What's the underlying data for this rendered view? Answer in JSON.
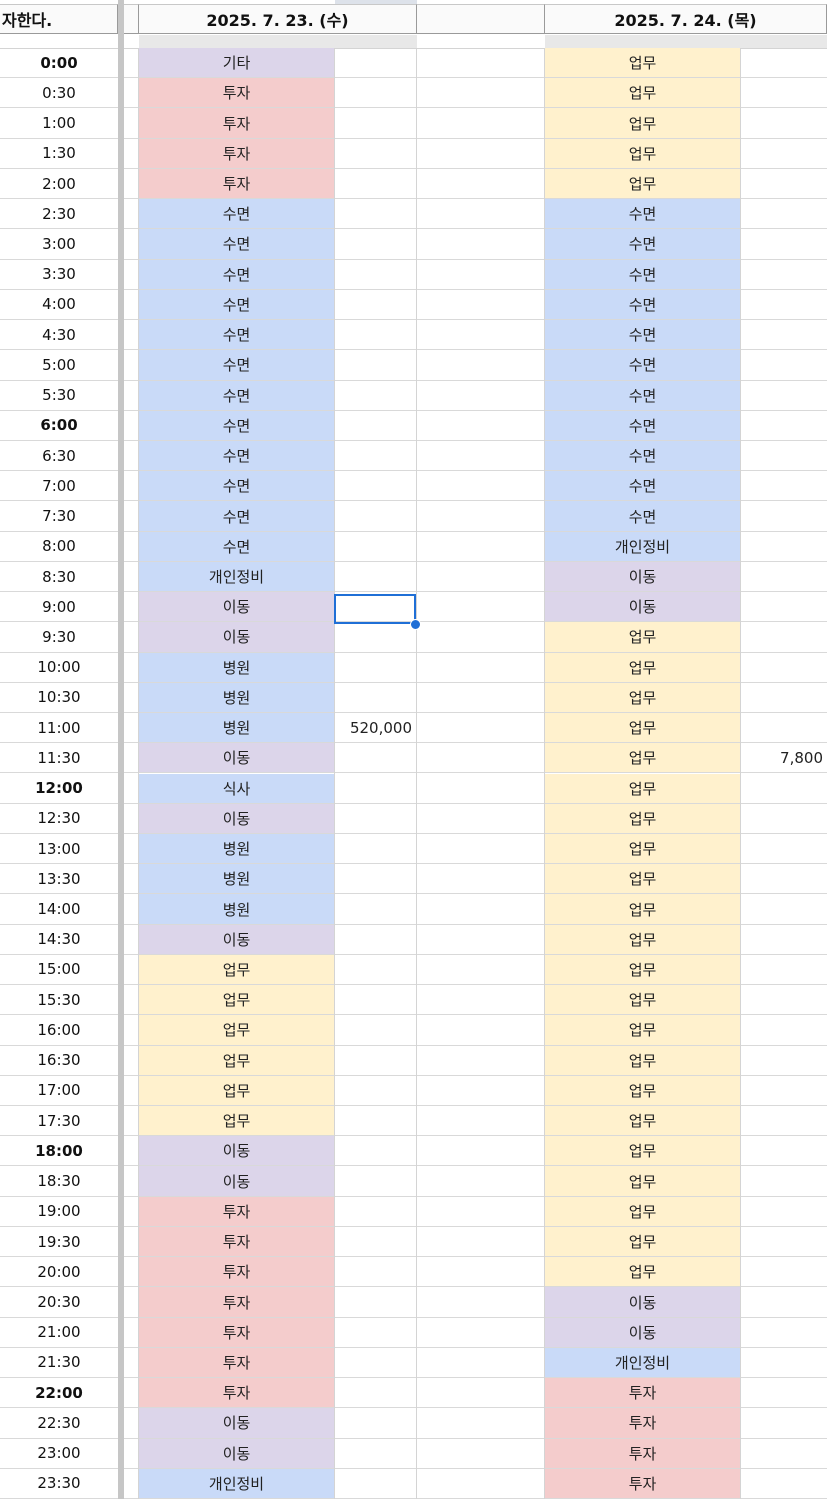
{
  "header": {
    "a": "자한다.",
    "date1": "2025. 7. 23. (수)",
    "date2": "2025. 7. 24. (목)"
  },
  "colors": {
    "기타": "#dcd5ea",
    "투자": "#f4cccc",
    "수면": "#c9daf8",
    "이동": "#dcd5ea",
    "병원": "#c9daf8",
    "개인정비": "#c9daf8",
    "식사": "#c9daf8",
    "업무": "#fff1cd"
  },
  "rows": [
    {
      "time": "0:00",
      "bold": true,
      "cat1": "기타",
      "amt1": "",
      "cat2": "업무",
      "amt2": ""
    },
    {
      "time": "0:30",
      "bold": false,
      "cat1": "투자",
      "amt1": "",
      "cat2": "업무",
      "amt2": ""
    },
    {
      "time": "1:00",
      "bold": false,
      "cat1": "투자",
      "amt1": "",
      "cat2": "업무",
      "amt2": ""
    },
    {
      "time": "1:30",
      "bold": false,
      "cat1": "투자",
      "amt1": "",
      "cat2": "업무",
      "amt2": ""
    },
    {
      "time": "2:00",
      "bold": false,
      "cat1": "투자",
      "amt1": "",
      "cat2": "업무",
      "amt2": ""
    },
    {
      "time": "2:30",
      "bold": false,
      "cat1": "수면",
      "amt1": "",
      "cat2": "수면",
      "amt2": ""
    },
    {
      "time": "3:00",
      "bold": false,
      "cat1": "수면",
      "amt1": "",
      "cat2": "수면",
      "amt2": ""
    },
    {
      "time": "3:30",
      "bold": false,
      "cat1": "수면",
      "amt1": "",
      "cat2": "수면",
      "amt2": ""
    },
    {
      "time": "4:00",
      "bold": false,
      "cat1": "수면",
      "amt1": "",
      "cat2": "수면",
      "amt2": ""
    },
    {
      "time": "4:30",
      "bold": false,
      "cat1": "수면",
      "amt1": "",
      "cat2": "수면",
      "amt2": ""
    },
    {
      "time": "5:00",
      "bold": false,
      "cat1": "수면",
      "amt1": "",
      "cat2": "수면",
      "amt2": ""
    },
    {
      "time": "5:30",
      "bold": false,
      "cat1": "수면",
      "amt1": "",
      "cat2": "수면",
      "amt2": ""
    },
    {
      "time": "6:00",
      "bold": true,
      "cat1": "수면",
      "amt1": "",
      "cat2": "수면",
      "amt2": ""
    },
    {
      "time": "6:30",
      "bold": false,
      "cat1": "수면",
      "amt1": "",
      "cat2": "수면",
      "amt2": ""
    },
    {
      "time": "7:00",
      "bold": false,
      "cat1": "수면",
      "amt1": "",
      "cat2": "수면",
      "amt2": ""
    },
    {
      "time": "7:30",
      "bold": false,
      "cat1": "수면",
      "amt1": "",
      "cat2": "수면",
      "amt2": ""
    },
    {
      "time": "8:00",
      "bold": false,
      "cat1": "수면",
      "amt1": "",
      "cat2": "개인정비",
      "amt2": ""
    },
    {
      "time": "8:30",
      "bold": false,
      "cat1": "개인정비",
      "amt1": "",
      "cat2": "이동",
      "amt2": ""
    },
    {
      "time": "9:00",
      "bold": false,
      "cat1": "이동",
      "amt1": "",
      "cat2": "이동",
      "amt2": ""
    },
    {
      "time": "9:30",
      "bold": false,
      "cat1": "이동",
      "amt1": "",
      "cat2": "업무",
      "amt2": ""
    },
    {
      "time": "10:00",
      "bold": false,
      "cat1": "병원",
      "amt1": "",
      "cat2": "업무",
      "amt2": ""
    },
    {
      "time": "10:30",
      "bold": false,
      "cat1": "병원",
      "amt1": "",
      "cat2": "업무",
      "amt2": ""
    },
    {
      "time": "11:00",
      "bold": false,
      "cat1": "병원",
      "amt1": "520,000",
      "cat2": "업무",
      "amt2": ""
    },
    {
      "time": "11:30",
      "bold": false,
      "cat1": "이동",
      "amt1": "",
      "cat2": "업무",
      "amt2": "7,800"
    },
    {
      "time": "12:00",
      "bold": true,
      "cat1": "식사",
      "amt1": "",
      "cat2": "업무",
      "amt2": ""
    },
    {
      "time": "12:30",
      "bold": false,
      "cat1": "이동",
      "amt1": "",
      "cat2": "업무",
      "amt2": ""
    },
    {
      "time": "13:00",
      "bold": false,
      "cat1": "병원",
      "amt1": "",
      "cat2": "업무",
      "amt2": ""
    },
    {
      "time": "13:30",
      "bold": false,
      "cat1": "병원",
      "amt1": "",
      "cat2": "업무",
      "amt2": ""
    },
    {
      "time": "14:00",
      "bold": false,
      "cat1": "병원",
      "amt1": "",
      "cat2": "업무",
      "amt2": ""
    },
    {
      "time": "14:30",
      "bold": false,
      "cat1": "이동",
      "amt1": "",
      "cat2": "업무",
      "amt2": ""
    },
    {
      "time": "15:00",
      "bold": false,
      "cat1": "업무",
      "amt1": "",
      "cat2": "업무",
      "amt2": ""
    },
    {
      "time": "15:30",
      "bold": false,
      "cat1": "업무",
      "amt1": "",
      "cat2": "업무",
      "amt2": ""
    },
    {
      "time": "16:00",
      "bold": false,
      "cat1": "업무",
      "amt1": "",
      "cat2": "업무",
      "amt2": ""
    },
    {
      "time": "16:30",
      "bold": false,
      "cat1": "업무",
      "amt1": "",
      "cat2": "업무",
      "amt2": ""
    },
    {
      "time": "17:00",
      "bold": false,
      "cat1": "업무",
      "amt1": "",
      "cat2": "업무",
      "amt2": ""
    },
    {
      "time": "17:30",
      "bold": false,
      "cat1": "업무",
      "amt1": "",
      "cat2": "업무",
      "amt2": ""
    },
    {
      "time": "18:00",
      "bold": true,
      "cat1": "이동",
      "amt1": "",
      "cat2": "업무",
      "amt2": ""
    },
    {
      "time": "18:30",
      "bold": false,
      "cat1": "이동",
      "amt1": "",
      "cat2": "업무",
      "amt2": ""
    },
    {
      "time": "19:00",
      "bold": false,
      "cat1": "투자",
      "amt1": "",
      "cat2": "업무",
      "amt2": ""
    },
    {
      "time": "19:30",
      "bold": false,
      "cat1": "투자",
      "amt1": "",
      "cat2": "업무",
      "amt2": ""
    },
    {
      "time": "20:00",
      "bold": false,
      "cat1": "투자",
      "amt1": "",
      "cat2": "업무",
      "amt2": ""
    },
    {
      "time": "20:30",
      "bold": false,
      "cat1": "투자",
      "amt1": "",
      "cat2": "이동",
      "amt2": ""
    },
    {
      "time": "21:00",
      "bold": false,
      "cat1": "투자",
      "amt1": "",
      "cat2": "이동",
      "amt2": ""
    },
    {
      "time": "21:30",
      "bold": false,
      "cat1": "투자",
      "amt1": "",
      "cat2": "개인정비",
      "amt2": ""
    },
    {
      "time": "22:00",
      "bold": true,
      "cat1": "투자",
      "amt1": "",
      "cat2": "투자",
      "amt2": ""
    },
    {
      "time": "22:30",
      "bold": false,
      "cat1": "이동",
      "amt1": "",
      "cat2": "투자",
      "amt2": ""
    },
    {
      "time": "23:00",
      "bold": false,
      "cat1": "이동",
      "amt1": "",
      "cat2": "투자",
      "amt2": ""
    },
    {
      "time": "23:30",
      "bold": false,
      "cat1": "개인정비",
      "amt1": "",
      "cat2": "투자",
      "amt2": ""
    }
  ]
}
